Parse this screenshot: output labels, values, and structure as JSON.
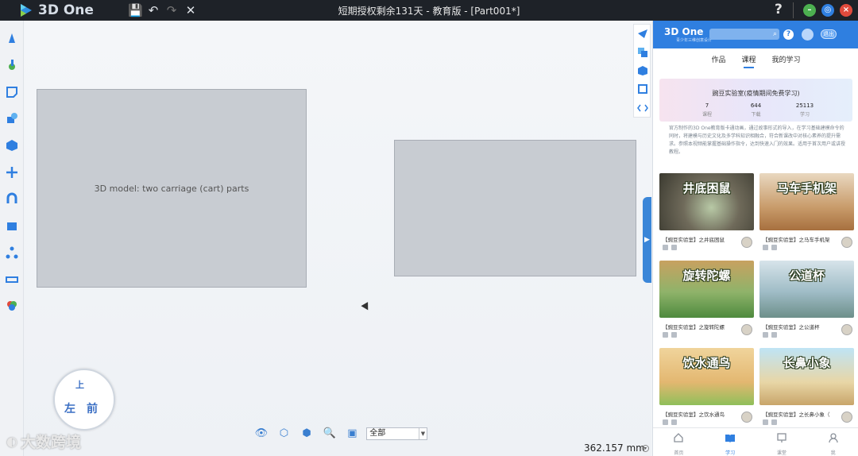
{
  "app": {
    "name": "3D One",
    "window_title": "短期授权剩余131天 - 教育版 - [Part001*]",
    "help": "?"
  },
  "viewport": {
    "model_label": "3D model: two carriage (cart) parts",
    "view_filter": "全部",
    "distance": "362.157 mm",
    "cube_faces": {
      "top": "上",
      "left": "左",
      "front": "前"
    }
  },
  "watermark": "大数跨境",
  "panel": {
    "logo": "3D One",
    "logo_sub": "青少年三维创意设计",
    "exit_label": "退出",
    "tabs": [
      {
        "label": "作品",
        "active": false
      },
      {
        "label": "课程",
        "active": true
      },
      {
        "label": "我的学习",
        "active": false
      }
    ],
    "hero": {
      "title": "豌豆实验室(疫情期间免费学习)",
      "stats": [
        {
          "value": "7",
          "label": "课程"
        },
        {
          "value": "644",
          "label": "下载"
        },
        {
          "value": "25113",
          "label": "学习"
        }
      ]
    },
    "intro": "官方制作的3D One教育版卡通动画，通过故事形式的导入，在学习基础建模命令的同时，将建模与历史文化及多学科知识相融合，符合新课改中对核心素养的提升需求。参照本视频能掌握基础操作指令，达到快速入门的效果。适用于首次用户或讲授教程。",
    "courses": [
      {
        "title": "井底困鼠",
        "label": "【豌豆实验室】之井底困鼠"
      },
      {
        "title": "马车手机架",
        "label": "【豌豆实验室】之马车手机架"
      },
      {
        "title": "旋转陀螺",
        "label": "【豌豆实验室】之旋转陀螺"
      },
      {
        "title": "公道杯",
        "label": "【豌豆实验室】之公道杯"
      },
      {
        "title": "饮水通鸟",
        "label": "【豌豆实验室】之饮水通鸟"
      },
      {
        "title": "长鼻小象",
        "label": "【豌豆实验室】之长鼻小象（"
      }
    ],
    "nav": [
      {
        "label": "首页",
        "active": false
      },
      {
        "label": "学习",
        "active": true
      },
      {
        "label": "课堂",
        "active": false
      },
      {
        "label": "我",
        "active": false
      }
    ]
  }
}
